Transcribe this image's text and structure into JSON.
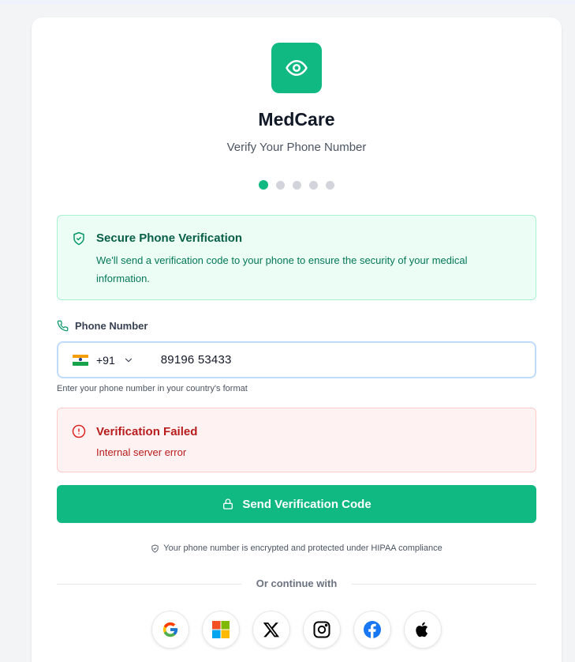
{
  "app": {
    "name": "MedCare",
    "subtitle": "Verify Your Phone Number"
  },
  "steps": {
    "total": 5,
    "current": 1
  },
  "info": {
    "title": "Secure Phone Verification",
    "description": "We'll send a verification code to your phone to ensure the security of your medical information."
  },
  "phone": {
    "label": "Phone Number",
    "country_code": "+91",
    "country": "India",
    "value": "89196 53433",
    "hint": "Enter your phone number in your country's format"
  },
  "error": {
    "title": "Verification Failed",
    "message": "Internal server error"
  },
  "actions": {
    "send_label": "Send Verification Code"
  },
  "security_note": "Your phone number is encrypted and protected under HIPAA compliance",
  "divider_text": "Or continue with",
  "social": [
    {
      "name": "Google",
      "icon": "google-icon"
    },
    {
      "name": "Microsoft",
      "icon": "microsoft-icon"
    },
    {
      "name": "X",
      "icon": "x-icon"
    },
    {
      "name": "Instagram",
      "icon": "instagram-icon"
    },
    {
      "name": "Facebook",
      "icon": "facebook-icon"
    },
    {
      "name": "Apple",
      "icon": "apple-icon"
    }
  ],
  "colors": {
    "accent": "#10b981",
    "info_bg": "#ecfdf5",
    "info_text": "#065f46",
    "error_bg": "#fef2f2",
    "error_text": "#b91c1c"
  }
}
